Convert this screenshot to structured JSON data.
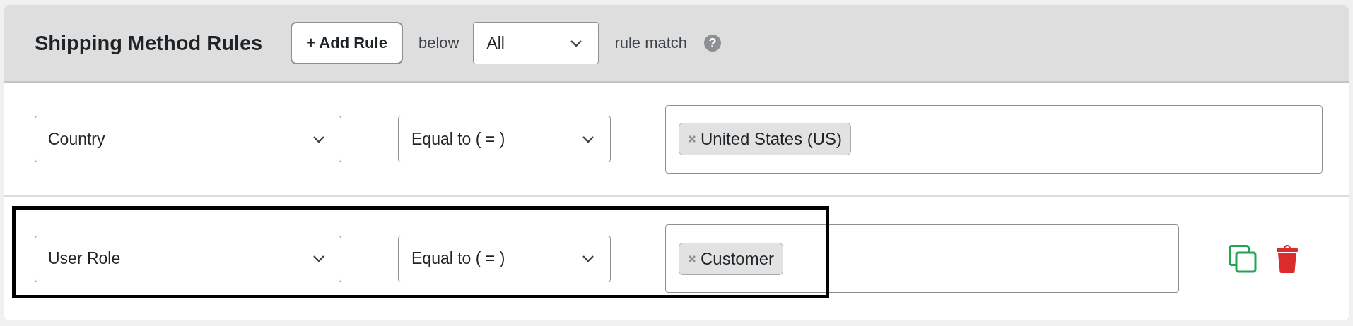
{
  "header": {
    "title": "Shipping Method Rules",
    "add_button": "+ Add Rule",
    "below_label": "below",
    "match_select": "All",
    "rule_match_label": "rule match",
    "help": "?"
  },
  "rules": [
    {
      "field": "Country",
      "operator": "Equal to ( = )",
      "values": [
        "United States (US)"
      ],
      "highlighted": false,
      "show_actions": false
    },
    {
      "field": "User Role",
      "operator": "Equal to ( = )",
      "values": [
        "Customer"
      ],
      "highlighted": true,
      "show_actions": true
    }
  ]
}
